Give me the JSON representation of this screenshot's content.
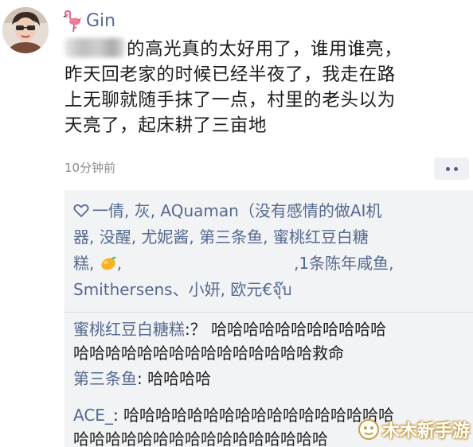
{
  "post": {
    "username": "Gin",
    "text_lines": [
      "的高光真的太好用了，谁用谁亮，",
      "昨天回老家的时候已经半夜了，我走在路",
      "上无聊就随手抹了一点，村里的老头以为",
      "天亮了，起床耕了三亩地"
    ],
    "timestamp": "10分钟前"
  },
  "likes": {
    "line1": "一倩, 灰, AQuaman（没有感情的做AI机",
    "line2": "器, 没醒, 尤妮酱, 第三条鱼, 蜜桃红豆白糖",
    "line3_a": "糕,",
    "line3_b": ",",
    "line3_c": ",1条陈年咸鱼,",
    "line4": "Smithersens、小妍, 欧元€จุ๊บ"
  },
  "comments": [
    {
      "author": "蜜桃红豆白糖糕",
      "first_text": ":？ 哈哈哈哈哈哈哈哈哈哈哈",
      "extra_lines": [
        "哈哈哈哈哈哈哈哈哈哈哈哈哈哈哈救命"
      ]
    },
    {
      "author": "第三条鱼",
      "first_text": ": 哈哈哈哈",
      "extra_lines": []
    },
    {
      "author": "ACE_",
      "first_text": ": 哈哈哈哈哈哈哈哈哈哈哈哈哈哈哈哈哈",
      "extra_lines": [
        "哈哈哈哈哈哈哈哈哈哈哈哈哈哈哈哈"
      ]
    }
  ],
  "watermark": {
    "text": "木木新手游"
  },
  "colors": {
    "link_blue": "#556a8f",
    "comment_bg": "#f2f3f5",
    "timestamp_gray": "#8a8a8a"
  },
  "icons": {
    "flamingo": "flamingo-icon",
    "heart": "heart-outline-icon",
    "mango": "mango-emoji-icon",
    "more": "more-dots-icon"
  }
}
